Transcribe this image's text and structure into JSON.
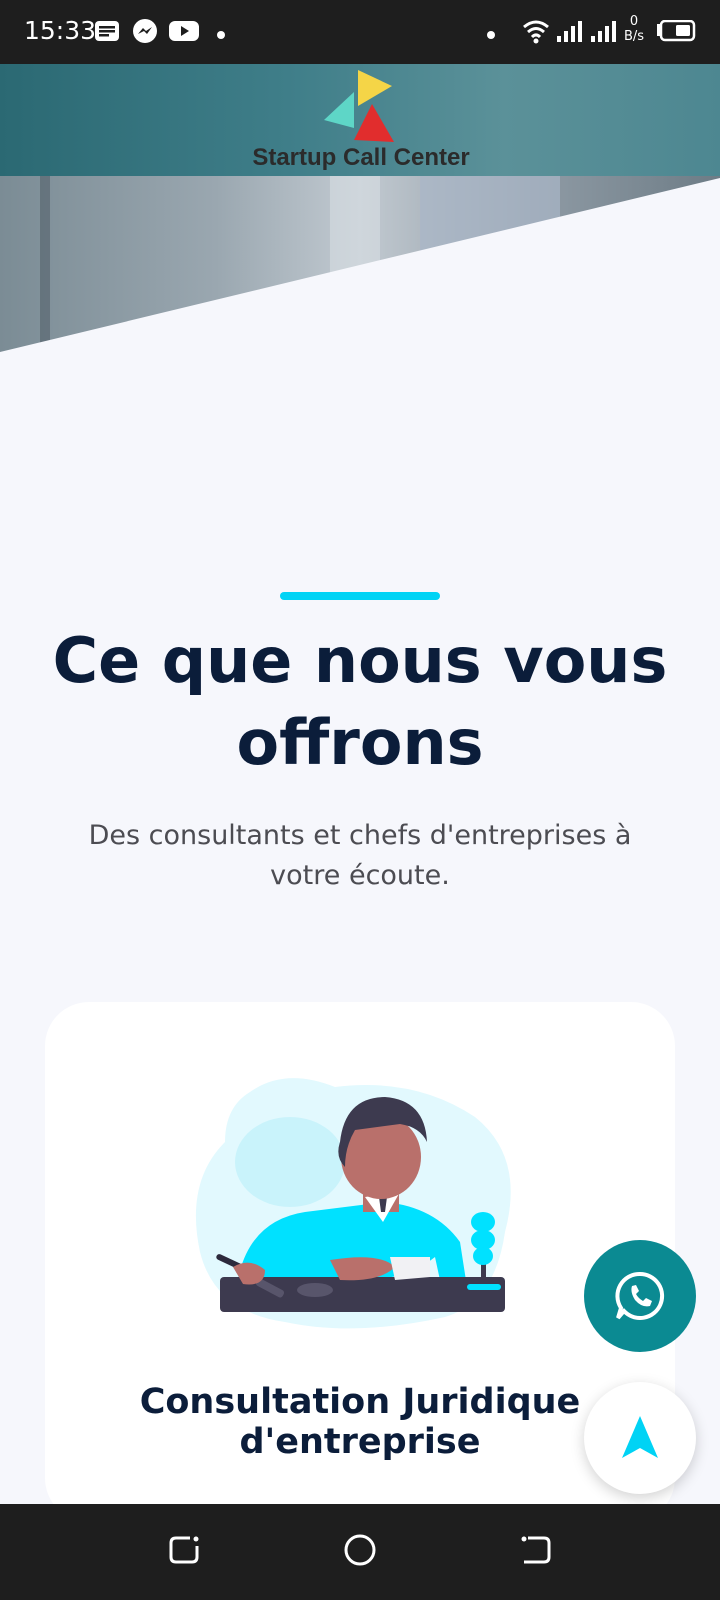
{
  "status_bar": {
    "time": "15:33",
    "data_rate_value": "0",
    "data_rate_unit": "B/s",
    "icons": [
      "notes-icon",
      "messenger-icon",
      "youtube-icon",
      "dot-icon",
      "dot-icon",
      "wifi-icon",
      "signal-icon",
      "signal-icon",
      "battery-icon"
    ]
  },
  "header": {
    "brand_name": "Startup Call Center",
    "logo_colors": [
      "#f5d547",
      "#5ed6c7",
      "#e12d2d"
    ]
  },
  "section": {
    "accent_color": "#00d3f5",
    "title": "Ce que nous vous offrons",
    "subtitle": "Des consultants et chefs d'entreprises à votre écoute."
  },
  "card": {
    "title": "Consultation Juridique d'entreprise",
    "illustration": "judge-illustration"
  },
  "fabs": {
    "whatsapp_icon": "whatsapp-icon",
    "whatsapp_color": "#0b8a92",
    "scroll_top_icon": "arrow-up-icon",
    "scroll_top_color": "#00d3f5"
  },
  "nav_bar": {
    "buttons": [
      "recent-apps-icon",
      "home-icon",
      "back-icon"
    ]
  }
}
